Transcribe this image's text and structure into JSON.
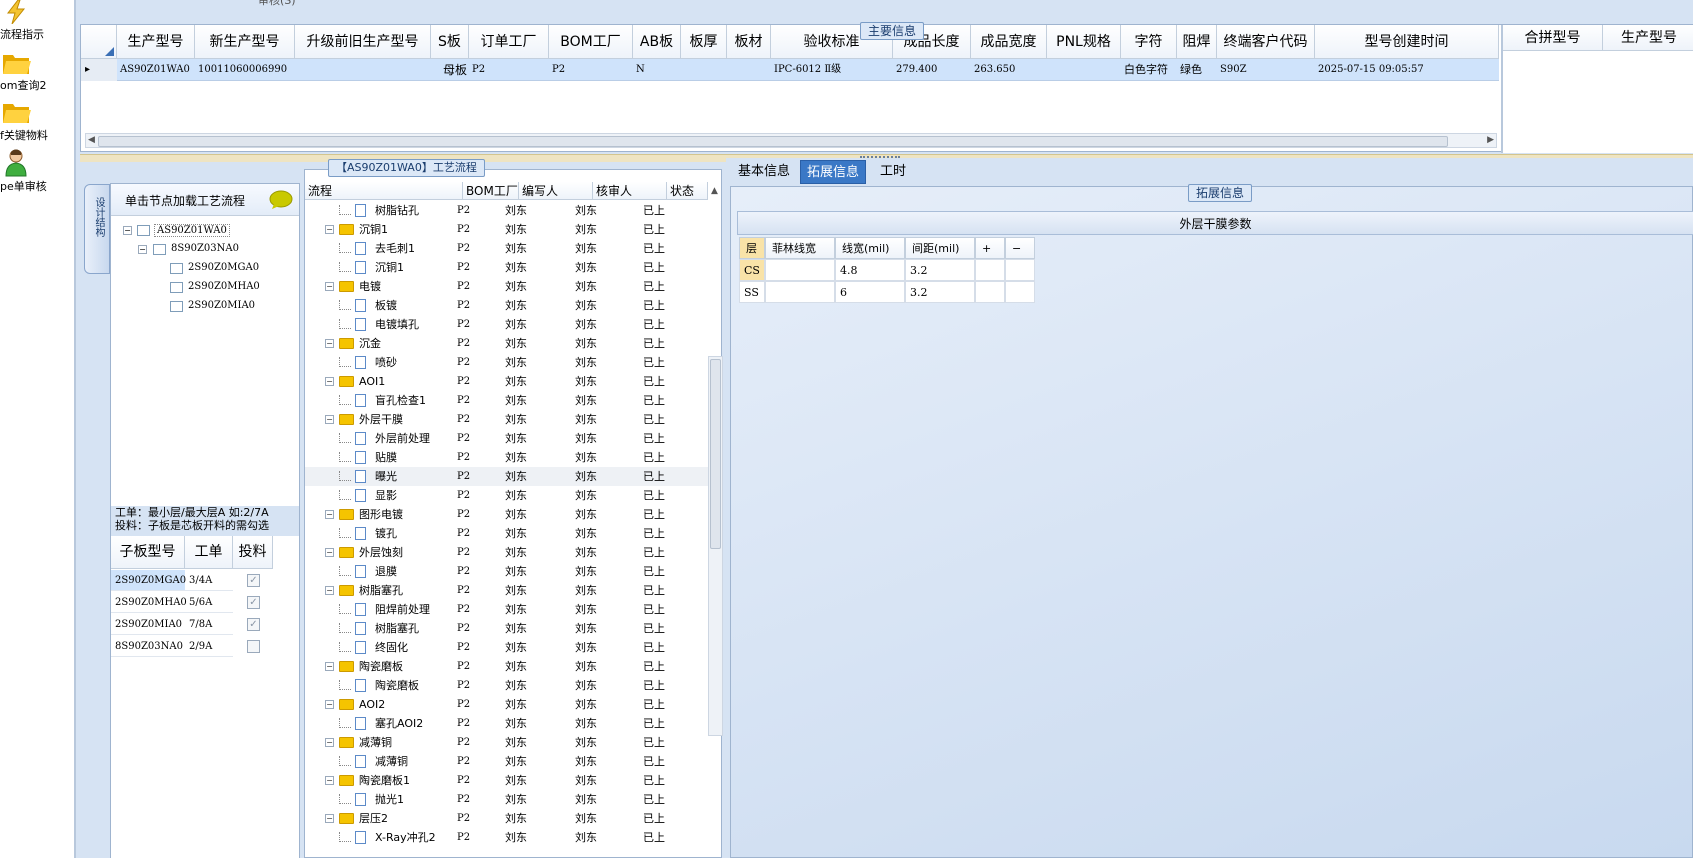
{
  "sidebar": {
    "items": [
      {
        "label": "流程指示",
        "icon": "lightning-icon"
      },
      {
        "label": "om查询2",
        "icon": "folder-open-icon"
      },
      {
        "label": "f关键物料",
        "icon": "folder-open-icon"
      },
      {
        "label": "pe单审核",
        "icon": "user-icon"
      }
    ]
  },
  "top": {
    "cut_text": "审核(S)"
  },
  "main_info": {
    "title": "主要信息",
    "columns": [
      "生产型号",
      "新生产型号",
      "升级前旧生产型号",
      "S板",
      "订单工厂",
      "BOM工厂",
      "AB板",
      "板厚",
      "板材",
      "验收标准",
      "成品长度",
      "成品宽度",
      "PNL规格",
      "字符",
      "阻焊",
      "终端客户代码",
      "型号创建时间"
    ],
    "row": [
      "AS90Z01WA0",
      "10011060006990",
      "",
      "母板",
      "P2",
      "P2",
      "N",
      "",
      "",
      "IPC-6012 Ⅱ级",
      "279.400",
      "263.650",
      "",
      "白色字符",
      "绿色",
      "S90Z",
      "2025-07-15 09:05:57"
    ],
    "right_columns": [
      "合拼型号",
      "生产型号"
    ]
  },
  "tree": {
    "tab_label": "设计结构",
    "header": "单击节点加载工艺流程",
    "nodes": [
      "AS90Z01WA0",
      "8S90Z03NA0",
      "2S90Z0MGA0",
      "2S90Z0MHA0",
      "2S90Z0MIA0"
    ],
    "note_line1": "工单：最小层/最大层A 如:2/7A",
    "note_line2": "投料：子板是芯板开料的需勾选"
  },
  "sub_table": {
    "columns": [
      "子板型号",
      "工单",
      "投料"
    ],
    "rows": [
      {
        "model": "2S90Z0MGA0",
        "order": "3/4A",
        "checked": "✓"
      },
      {
        "model": "2S90Z0MHA0",
        "order": "5/6A",
        "checked": "✓"
      },
      {
        "model": "2S90Z0MIA0",
        "order": "7/8A",
        "checked": "✓"
      },
      {
        "model": "8S90Z03NA0",
        "order": "2/9A",
        "checked": ""
      }
    ]
  },
  "process": {
    "title": "【AS90Z01WA0】工艺流程",
    "columns": [
      "流程",
      "BOM工厂",
      "编写人",
      "核审人",
      "状态"
    ],
    "factory": "P2",
    "writer": "刘东",
    "reviewer": "刘东",
    "status": "已上",
    "rows": [
      {
        "name": "树脂钻孔",
        "folder": false
      },
      {
        "name": "沉铜1",
        "folder": true
      },
      {
        "name": "去毛刺1",
        "folder": false
      },
      {
        "name": "沉铜1",
        "folder": false
      },
      {
        "name": "电镀",
        "folder": true
      },
      {
        "name": "板镀",
        "folder": false
      },
      {
        "name": "电镀填孔",
        "folder": false
      },
      {
        "name": "沉金",
        "folder": true
      },
      {
        "name": "喷砂",
        "folder": false
      },
      {
        "name": "AOI1",
        "folder": true
      },
      {
        "name": "盲孔检查1",
        "folder": false
      },
      {
        "name": "外层干膜",
        "folder": true
      },
      {
        "name": "外层前处理",
        "folder": false
      },
      {
        "name": "贴膜",
        "folder": false
      },
      {
        "name": "曝光",
        "folder": false
      },
      {
        "name": "显影",
        "folder": false
      },
      {
        "name": "图形电镀",
        "folder": true
      },
      {
        "name": "镀孔",
        "folder": false
      },
      {
        "name": "外层蚀刻",
        "folder": true
      },
      {
        "name": "退膜",
        "folder": false
      },
      {
        "name": "树脂塞孔",
        "folder": true
      },
      {
        "name": "阻焊前处理",
        "folder": false
      },
      {
        "name": "树脂塞孔",
        "folder": false
      },
      {
        "name": "终固化",
        "folder": false
      },
      {
        "name": "陶瓷磨板",
        "folder": true
      },
      {
        "name": "陶瓷磨板",
        "folder": false
      },
      {
        "name": "AOI2",
        "folder": true
      },
      {
        "name": "塞孔AOI2",
        "folder": false
      },
      {
        "name": "减薄铜",
        "folder": true
      },
      {
        "name": "减薄铜",
        "folder": false
      },
      {
        "name": "陶瓷磨板1",
        "folder": true
      },
      {
        "name": "抛光1",
        "folder": false
      },
      {
        "name": "层压2",
        "folder": true
      },
      {
        "name": "X-Ray冲孔2",
        "folder": false
      }
    ]
  },
  "right": {
    "tabs": [
      "基本信息",
      "拓展信息",
      "工时"
    ],
    "active_tab": "拓展信息",
    "group_title": "拓展信息",
    "grid_title": "外层干膜参数",
    "grid_columns": [
      "层",
      "菲林线宽",
      "线宽(mil)",
      "间距(mil)",
      "+",
      "−"
    ],
    "grid_rows": [
      {
        "layer": "CS",
        "film": "",
        "width": "4.8",
        "space": "3.2"
      },
      {
        "layer": "SS",
        "film": "",
        "width": "6",
        "space": "3.2"
      }
    ]
  },
  "colors": {
    "selection": "#cfe3fb",
    "tab_active": "#3a78c6",
    "folder": "#f5c400"
  }
}
